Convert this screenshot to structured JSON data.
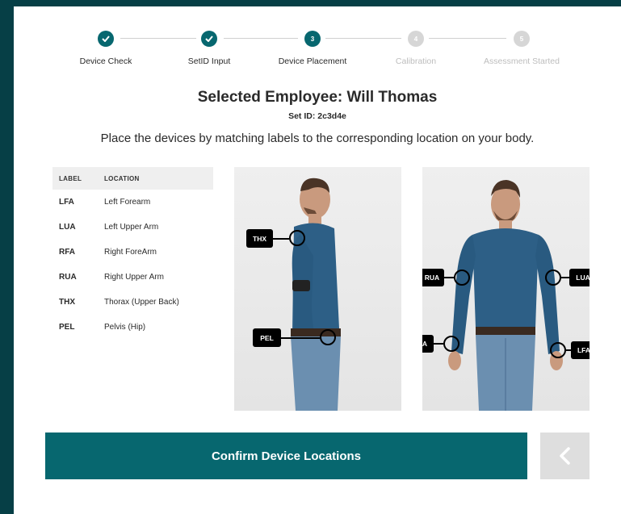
{
  "stepper": {
    "steps": [
      {
        "label": "Device Check",
        "marker": "",
        "state": "done",
        "icon": "check-icon"
      },
      {
        "label": "SetID Input",
        "marker": "",
        "state": "done",
        "icon": "check-icon"
      },
      {
        "label": "Device Placement",
        "marker": "3",
        "state": "active"
      },
      {
        "label": "Calibration",
        "marker": "4",
        "state": "pending"
      },
      {
        "label": "Assessment Started",
        "marker": "5",
        "state": "pending"
      }
    ]
  },
  "header": {
    "title": "Selected Employee: Will Thomas",
    "set_id": "Set ID: 2c3d4e",
    "instruction": "Place the devices by matching labels to the corresponding location on your body."
  },
  "table": {
    "headers": {
      "label": "LABEL",
      "location": "LOCATION"
    },
    "rows": [
      {
        "label": "LFA",
        "location": "Left Forearm"
      },
      {
        "label": "LUA",
        "location": "Left Upper Arm"
      },
      {
        "label": "RFA",
        "location": "Right ForeArm"
      },
      {
        "label": "RUA",
        "location": "Right Upper Arm"
      },
      {
        "label": "THX",
        "location": "Thorax (Upper Back)"
      },
      {
        "label": "PEL",
        "location": "Pelvis (Hip)"
      }
    ]
  },
  "figures": {
    "side": {
      "tags": {
        "thx": "THX",
        "pel": "PEL"
      }
    },
    "front": {
      "tags": {
        "rua": "RUA",
        "lua": "LUA",
        "rfa": "RFA",
        "lfa": "LFA"
      }
    }
  },
  "actions": {
    "confirm_label": "Confirm Device Locations",
    "back_icon": "chevron-left-icon"
  },
  "colors": {
    "accent": "#07676f",
    "background": "#063f46",
    "pending": "#d6d6d6"
  }
}
